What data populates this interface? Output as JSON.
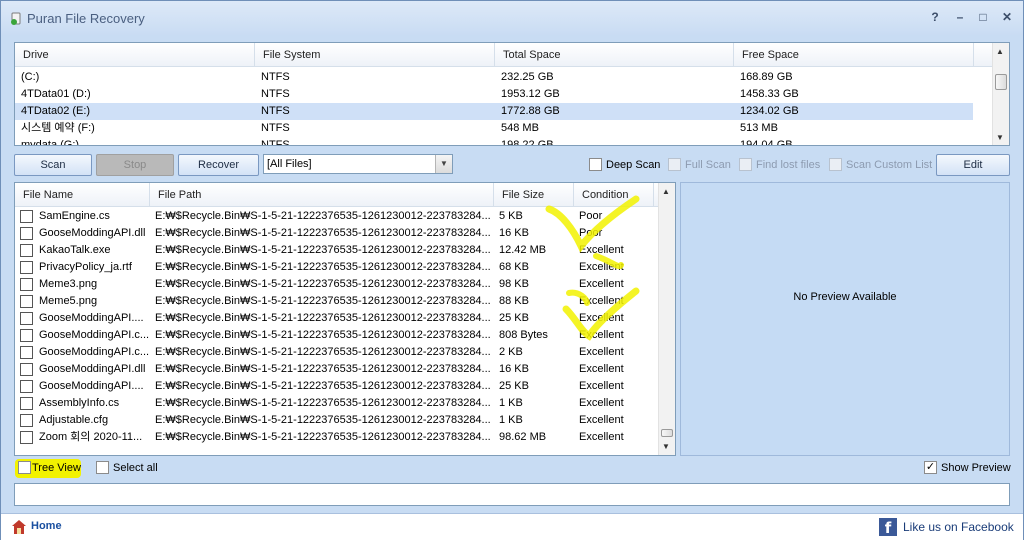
{
  "window": {
    "title": "Puran File Recovery"
  },
  "titlebar_buttons": {
    "help": "?",
    "minimize": "–",
    "maximize": "□",
    "close": "✕"
  },
  "drives": {
    "columns": [
      "Drive",
      "File System",
      "Total Space",
      "Free Space"
    ],
    "rows": [
      {
        "drive": " (C:)",
        "fs": "NTFS",
        "total": "232.25 GB",
        "free": "168.89 GB",
        "selected": false
      },
      {
        "drive": "4TData01 (D:)",
        "fs": "NTFS",
        "total": "1953.12 GB",
        "free": "1458.33 GB",
        "selected": false
      },
      {
        "drive": "4TData02 (E:)",
        "fs": "NTFS",
        "total": "1772.88 GB",
        "free": "1234.02 GB",
        "selected": true
      },
      {
        "drive": "시스템 예약 (F:)",
        "fs": "NTFS",
        "total": "548 MB",
        "free": "513 MB",
        "selected": false
      },
      {
        "drive": "mydata (G:)",
        "fs": "NTFS",
        "total": "198.22 GB",
        "free": "194.04 GB",
        "selected": false
      }
    ]
  },
  "toolbar": {
    "scan": "Scan",
    "stop": "Stop",
    "recover": "Recover",
    "filter_value": "[All Files]",
    "deep_scan": "Deep Scan",
    "full_scan": "Full Scan",
    "find_lost": "Find lost files",
    "scan_custom": "Scan Custom List",
    "edit": "Edit"
  },
  "files": {
    "columns": [
      "File Name",
      "File Path",
      "File Size",
      "Condition"
    ],
    "rows": [
      {
        "name": "SamEngine.cs",
        "path": "E:₩$Recycle.Bin₩S-1-5-21-1222376535-1261230012-223783284...",
        "size": "5 KB",
        "cond": "Poor"
      },
      {
        "name": "GooseModdingAPI.dll",
        "path": "E:₩$Recycle.Bin₩S-1-5-21-1222376535-1261230012-223783284...",
        "size": "16 KB",
        "cond": "Poor"
      },
      {
        "name": "KakaoTalk.exe",
        "path": "E:₩$Recycle.Bin₩S-1-5-21-1222376535-1261230012-223783284...",
        "size": "12.42 MB",
        "cond": "Excellent"
      },
      {
        "name": "PrivacyPolicy_ja.rtf",
        "path": "E:₩$Recycle.Bin₩S-1-5-21-1222376535-1261230012-223783284...",
        "size": "68 KB",
        "cond": "Excellent"
      },
      {
        "name": "Meme3.png",
        "path": "E:₩$Recycle.Bin₩S-1-5-21-1222376535-1261230012-223783284...",
        "size": "98 KB",
        "cond": "Excellent"
      },
      {
        "name": "Meme5.png",
        "path": "E:₩$Recycle.Bin₩S-1-5-21-1222376535-1261230012-223783284...",
        "size": "88 KB",
        "cond": "Excellent"
      },
      {
        "name": "GooseModdingAPI....",
        "path": "E:₩$Recycle.Bin₩S-1-5-21-1222376535-1261230012-223783284...",
        "size": "25 KB",
        "cond": "Excellent"
      },
      {
        "name": "GooseModdingAPI.c...",
        "path": "E:₩$Recycle.Bin₩S-1-5-21-1222376535-1261230012-223783284...",
        "size": "808 Bytes",
        "cond": "Excellent"
      },
      {
        "name": "GooseModdingAPI.c...",
        "path": "E:₩$Recycle.Bin₩S-1-5-21-1222376535-1261230012-223783284...",
        "size": "2 KB",
        "cond": "Excellent"
      },
      {
        "name": "GooseModdingAPI.dll",
        "path": "E:₩$Recycle.Bin₩S-1-5-21-1222376535-1261230012-223783284...",
        "size": "16 KB",
        "cond": "Excellent"
      },
      {
        "name": "GooseModdingAPI....",
        "path": "E:₩$Recycle.Bin₩S-1-5-21-1222376535-1261230012-223783284...",
        "size": "25 KB",
        "cond": "Excellent"
      },
      {
        "name": "AssemblyInfo.cs",
        "path": "E:₩$Recycle.Bin₩S-1-5-21-1222376535-1261230012-223783284...",
        "size": "1 KB",
        "cond": "Excellent"
      },
      {
        "name": "Adjustable.cfg",
        "path": "E:₩$Recycle.Bin₩S-1-5-21-1222376535-1261230012-223783284...",
        "size": "1 KB",
        "cond": "Excellent"
      },
      {
        "name": "Zoom 회의 2020-11...",
        "path": "E:₩$Recycle.Bin₩S-1-5-21-1222376535-1261230012-223783284...",
        "size": "98.62 MB",
        "cond": "Excellent"
      }
    ]
  },
  "preview": {
    "text": "No Preview Available"
  },
  "options": {
    "tree_view": "Tree View",
    "select_all": "Select all",
    "show_preview": "Show Preview",
    "show_preview_checked": true
  },
  "status": {
    "value": ""
  },
  "footer": {
    "home": "Home",
    "facebook": "Like us on Facebook"
  },
  "colors": {
    "highlight": "#f2f200",
    "selected_row": "#cfe0f7",
    "window_bg": "#c8dcf3"
  }
}
